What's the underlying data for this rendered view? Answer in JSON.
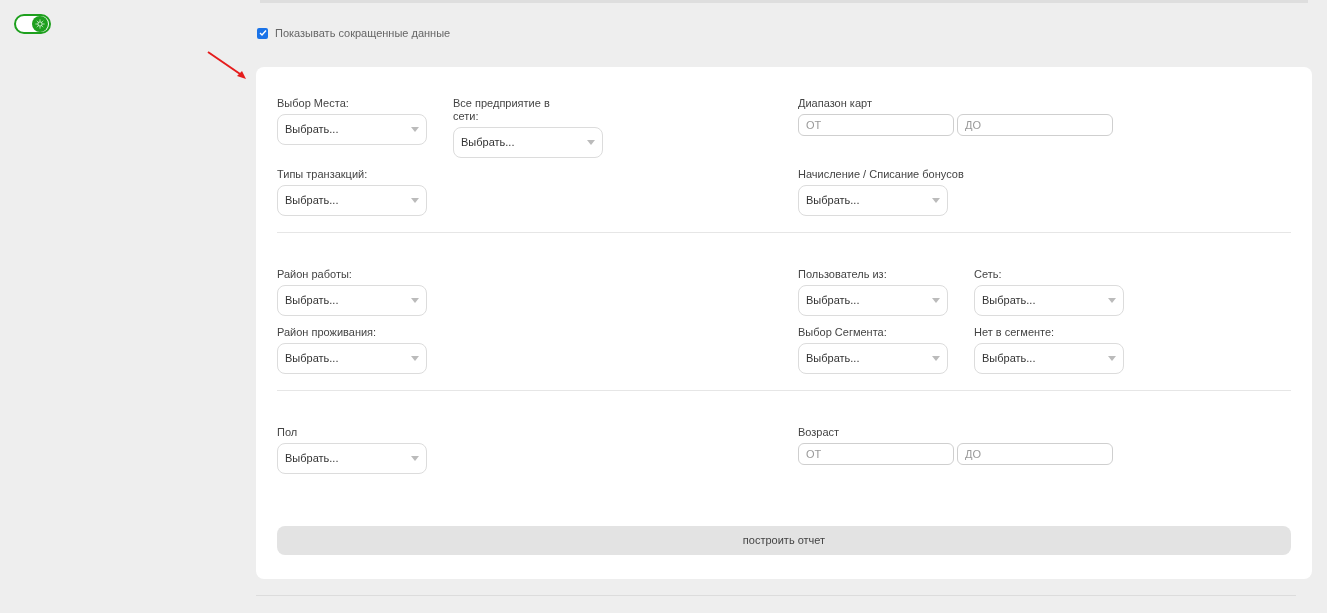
{
  "theme_toggle": {
    "on": true
  },
  "short_data": {
    "label": "Показывать сокращенные данные",
    "checked": true
  },
  "sections": [
    {
      "rows": [
        {
          "left": [
            {
              "kind": "select",
              "label": "Выбор Места:",
              "value": "Выбрать..."
            },
            {
              "kind": "select",
              "label": "Все предприятие в сети:",
              "value": "Выбрать..."
            }
          ],
          "right": [
            {
              "kind": "range",
              "label": "Диапазон карт",
              "inputs": [
                {
                  "placeholder": "ОТ"
                },
                {
                  "placeholder": "ДО"
                }
              ]
            }
          ]
        },
        {
          "left": [
            {
              "kind": "select",
              "label": "Типы транзакций:",
              "value": "Выбрать..."
            }
          ],
          "right": [
            {
              "kind": "select",
              "label": "Начисление / Списание бонусов",
              "value": "Выбрать..."
            }
          ]
        }
      ]
    },
    {
      "rows": [
        {
          "left": [
            {
              "kind": "select",
              "label": "Район работы:",
              "value": "Выбрать..."
            }
          ],
          "right": [
            {
              "kind": "select",
              "label": "Пользователь из:",
              "value": "Выбрать..."
            },
            {
              "kind": "select",
              "label": "Сеть:",
              "value": "Выбрать..."
            }
          ]
        },
        {
          "left": [
            {
              "kind": "select",
              "label": "Район проживания:",
              "value": "Выбрать..."
            }
          ],
          "right": [
            {
              "kind": "select",
              "label": "Выбор Сегмента:",
              "value": "Выбрать..."
            },
            {
              "kind": "select",
              "label": "Нет в сегменте:",
              "value": "Выбрать..."
            }
          ]
        }
      ]
    },
    {
      "rows": [
        {
          "left": [
            {
              "kind": "select",
              "label": "Пол",
              "value": "Выбрать..."
            }
          ],
          "right": [
            {
              "kind": "range",
              "label": "Возраст",
              "inputs": [
                {
                  "placeholder": "ОТ"
                },
                {
                  "placeholder": "ДО"
                }
              ]
            }
          ]
        }
      ]
    }
  ],
  "submit": "построить отчет"
}
